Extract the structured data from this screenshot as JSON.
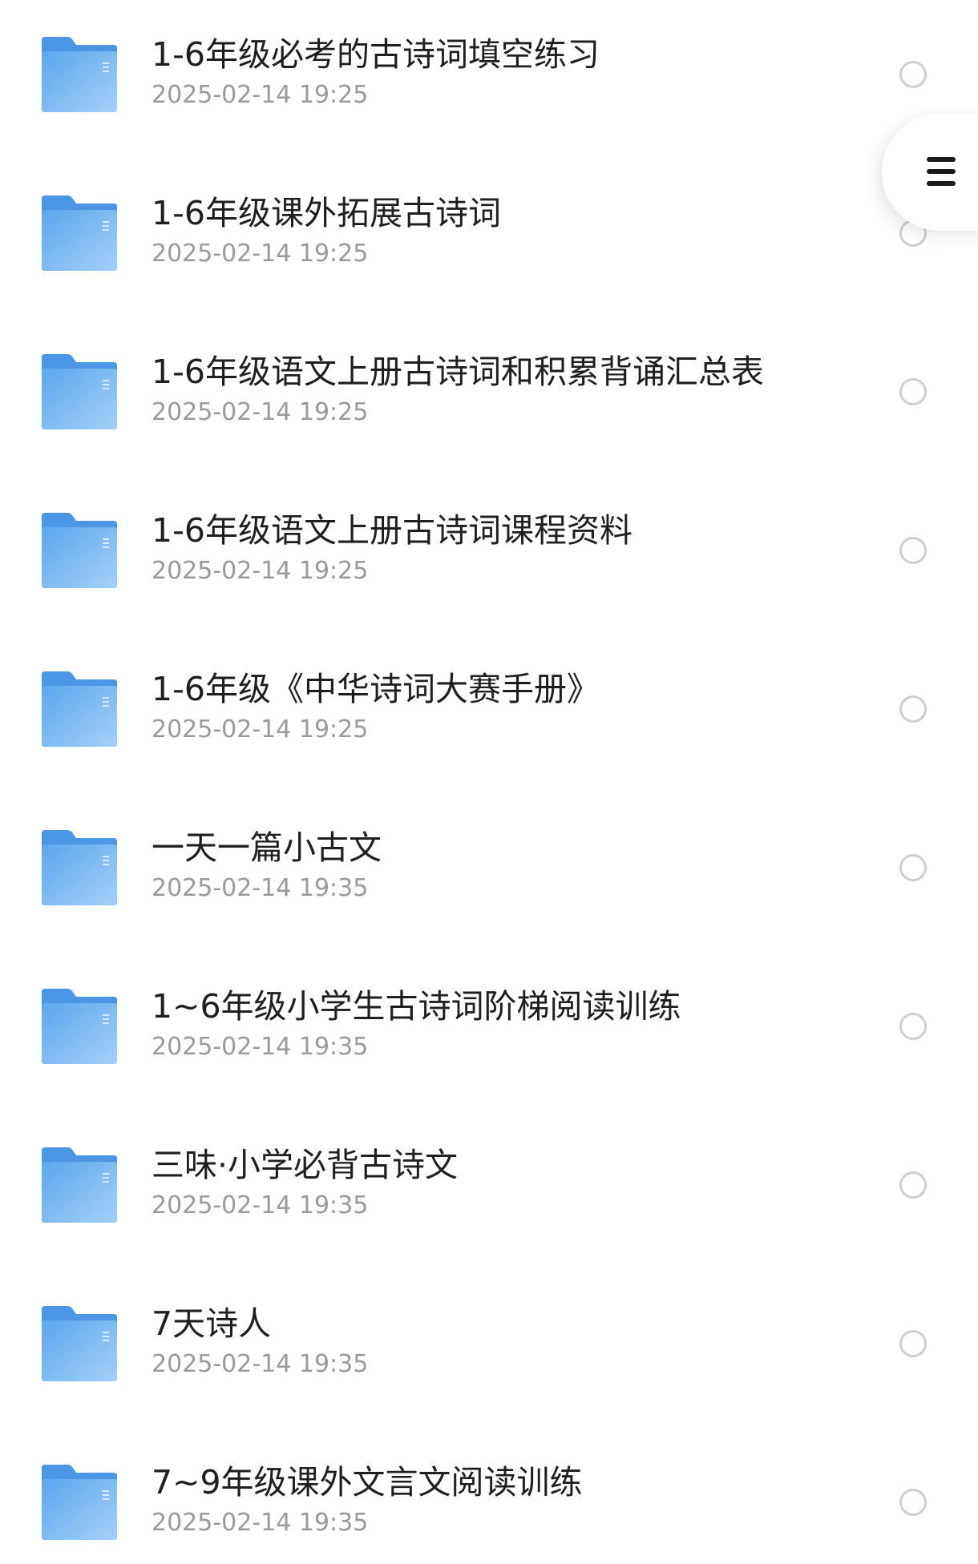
{
  "colors": {
    "folder_top": "#5aa7ef",
    "folder_bottom": "#9ccbf8",
    "folder_tab": "#4b97e6",
    "name_text": "#1f1f1f",
    "date_text": "#9a9a9a",
    "radio_border": "#cfcfcf"
  },
  "icons": {
    "folder": "folder-icon",
    "menu": "menu-icon",
    "select": "radio-circle-icon"
  },
  "files": [
    {
      "name": "1-6年级必考的古诗词填空练习",
      "date": "2025-02-14 19:25"
    },
    {
      "name": "1-6年级课外拓展古诗词",
      "date": "2025-02-14 19:25"
    },
    {
      "name": "1-6年级语文上册古诗词和积累背诵汇总表",
      "date": "2025-02-14 19:25"
    },
    {
      "name": "1-6年级语文上册古诗词课程资料",
      "date": "2025-02-14 19:25"
    },
    {
      "name": "1-6年级《中华诗词大赛手册》",
      "date": "2025-02-14 19:25"
    },
    {
      "name": "一天一篇小古文",
      "date": "2025-02-14 19:35"
    },
    {
      "name": "1~6年级小学生古诗词阶梯阅读训练",
      "date": "2025-02-14 19:35"
    },
    {
      "name": "三味·小学必背古诗文",
      "date": "2025-02-14 19:35"
    },
    {
      "name": "7天诗人",
      "date": "2025-02-14 19:35"
    },
    {
      "name": "7~9年级课外文言文阅读训练",
      "date": "2025-02-14 19:35"
    }
  ]
}
